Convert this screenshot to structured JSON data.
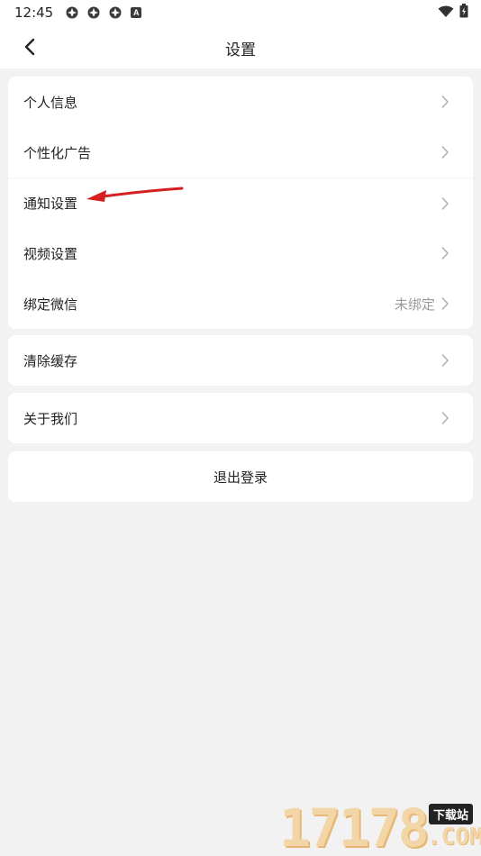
{
  "status_bar": {
    "time": "12:45",
    "icons": [
      "app-icon",
      "app-icon",
      "app-icon",
      "a-notification-icon",
      "wifi-icon",
      "battery-charging-icon"
    ],
    "a_glyph": "A"
  },
  "nav": {
    "title": "设置",
    "back_icon": "chevron-left-icon"
  },
  "groups": [
    {
      "items": [
        {
          "label": "个人信息",
          "value": ""
        },
        {
          "label": "个性化广告",
          "value": ""
        },
        {
          "label": "通知设置",
          "value": ""
        },
        {
          "label": "视频设置",
          "value": ""
        },
        {
          "label": "绑定微信",
          "value": "未绑定"
        }
      ]
    },
    {
      "items": [
        {
          "label": "清除缓存",
          "value": ""
        }
      ]
    },
    {
      "items": [
        {
          "label": "关于我们",
          "value": ""
        }
      ]
    }
  ],
  "logout": {
    "label": "退出登录"
  },
  "annotation": {
    "arrow_color": "#d62020",
    "points_to": "通知设置"
  },
  "watermark": {
    "digits": "17178",
    "badge": "下载站",
    "suffix": ".COM"
  },
  "colors": {
    "background": "#f2f2f2",
    "card": "#ffffff",
    "text": "#222222",
    "secondary_text": "#999999",
    "chevron": "#b0b0b0"
  }
}
